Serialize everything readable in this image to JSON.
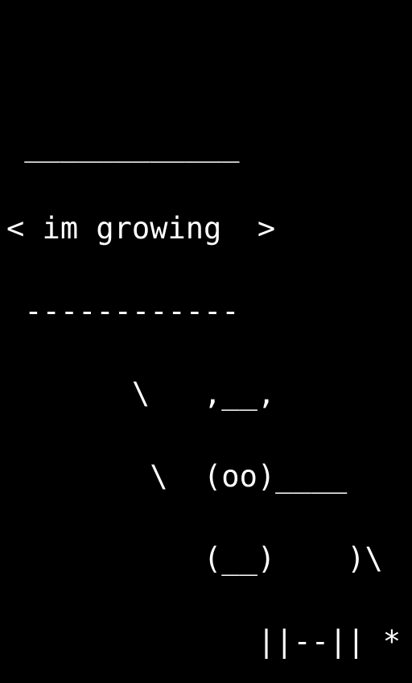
{
  "background_color": "#000000",
  "text_color": "#ffffff",
  "art": {
    "lines": [
      " ____________",
      "< im growing  >",
      " ------------",
      "       \\   ,__,",
      "        \\  (oo)____",
      "           (__)    )\\",
      "              ||--|| *"
    ]
  }
}
